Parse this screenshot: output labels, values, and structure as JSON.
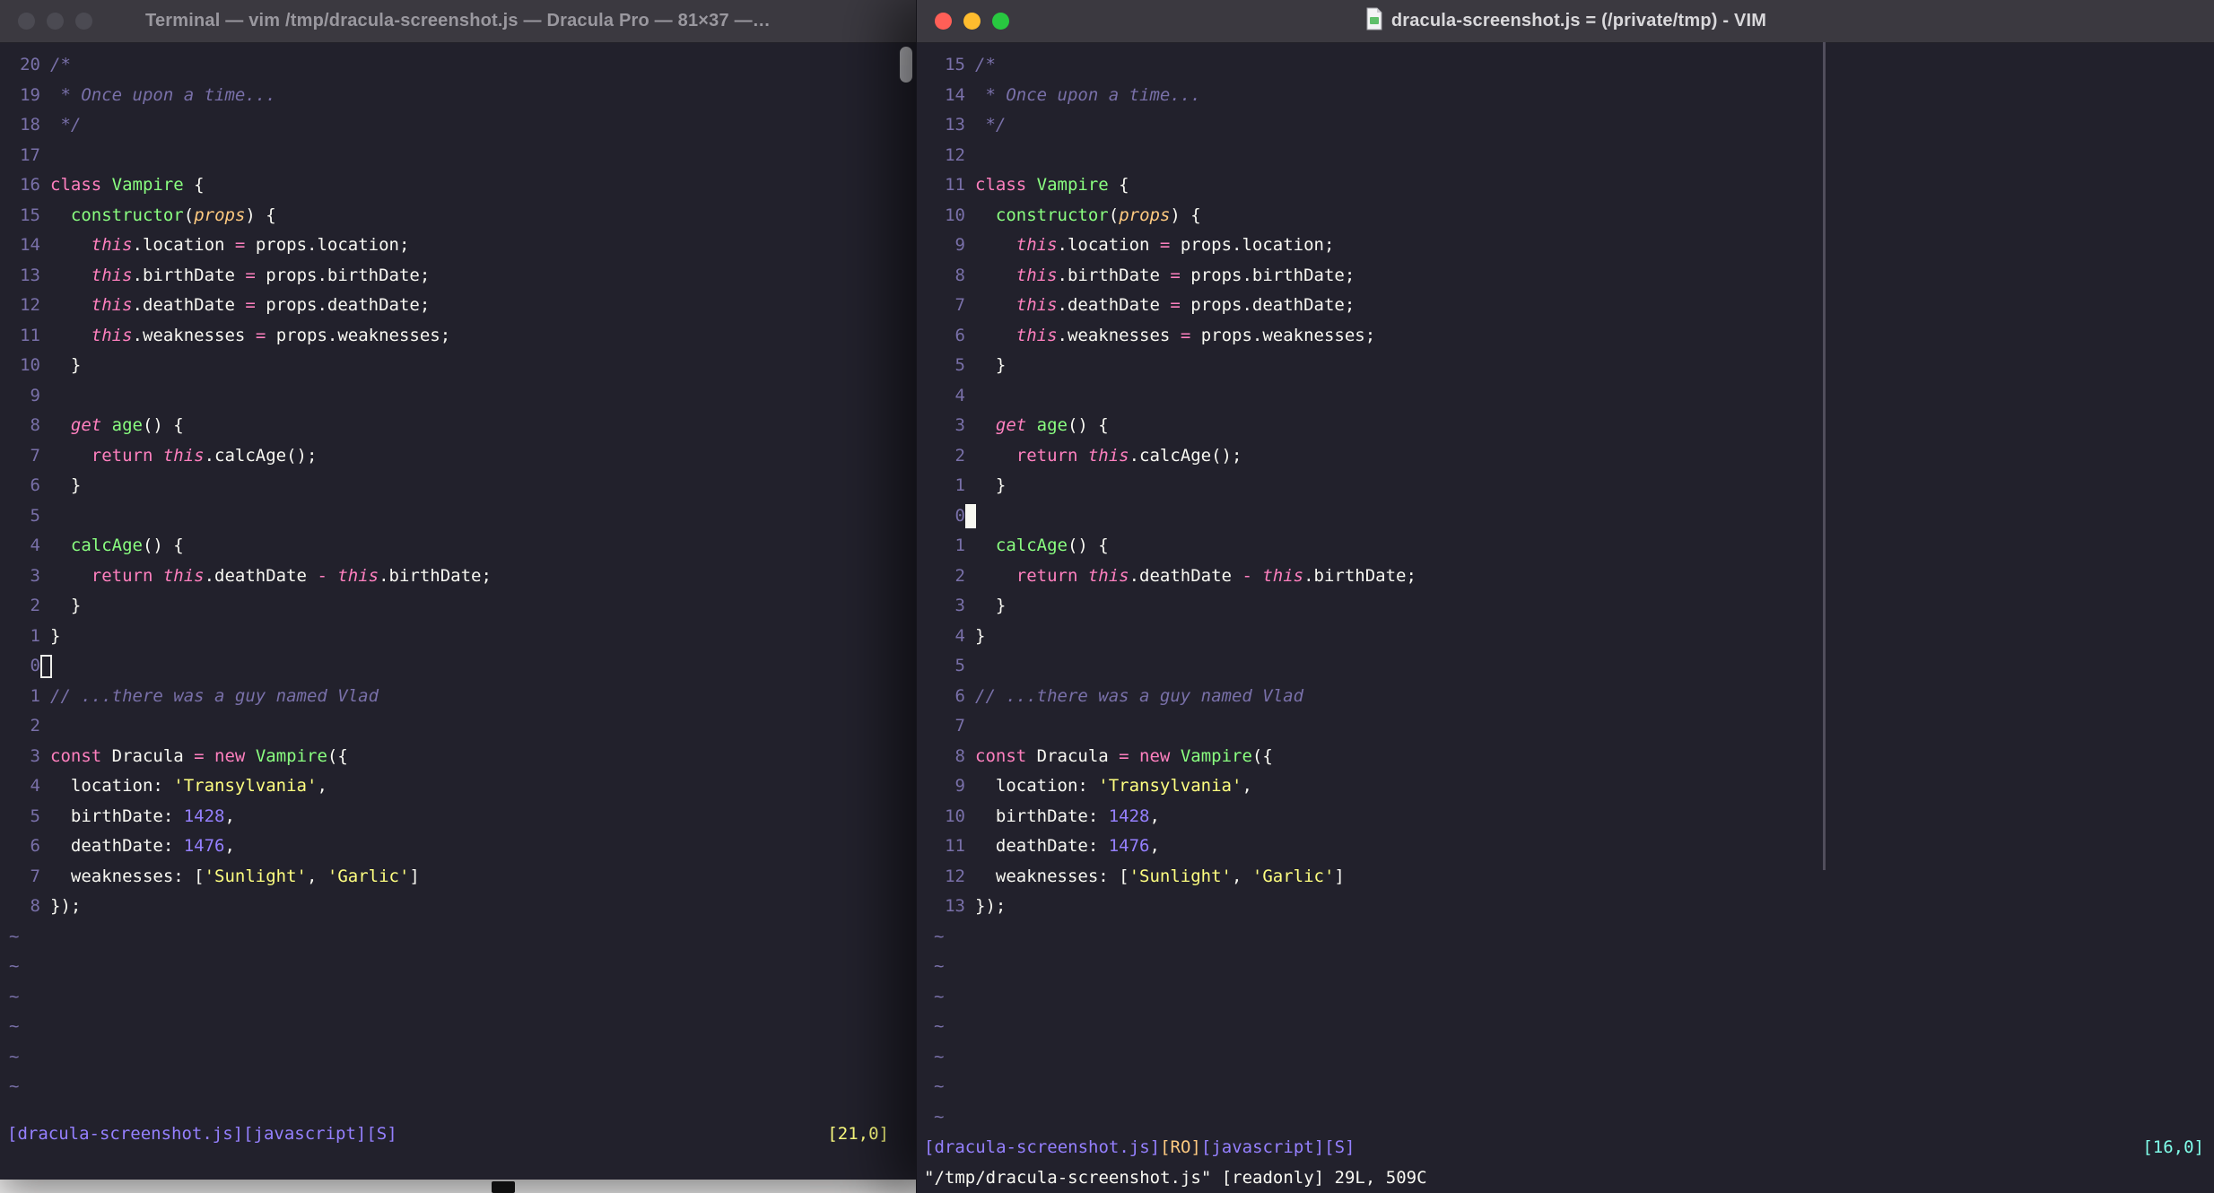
{
  "colors": {
    "background": "#22212C",
    "foreground": "#F8F8F2",
    "comment": "#7970A9",
    "pink": "#FF80BF",
    "green": "#8AFF80",
    "purple": "#9580FF",
    "yellow": "#FFFF80",
    "orange": "#FFCA80",
    "cyan": "#80FFEA",
    "titlebar": "#3b3940",
    "traffic_red": "#FF5F57",
    "traffic_yellow": "#FEBC2E",
    "traffic_green": "#28C840"
  },
  "tilde": "~",
  "left_window": {
    "title": "Terminal — vim /tmp/dracula-screenshot.js — Dracula Pro — 81×37 —…",
    "cursor_line": 21,
    "cursor_style": "hollow",
    "tilde_count": 6,
    "status_parts": [
      {
        "text": "[dracula-screenshot.js][javascript][S]",
        "color": "#9580FF"
      }
    ],
    "ruler": "[21,0]",
    "ruler_color": "#FFFF80",
    "command_line": ""
  },
  "right_window": {
    "title": "dracula-screenshot.js = (/private/tmp) - VIM",
    "cursor_line": 16,
    "cursor_style": "block",
    "tilde_count": 7,
    "status_parts": [
      {
        "text": "[dracula-screenshot.js]",
        "color": "#9580FF"
      },
      {
        "text": "[RO]",
        "color": "#FFCA80"
      },
      {
        "text": "[javascript][S]",
        "color": "#9580FF"
      }
    ],
    "ruler": "[16,0]",
    "ruler_color": "#80FFEA",
    "command_line": "\"/tmp/dracula-screenshot.js\" [readonly] 29L, 509C"
  },
  "code_lines": [
    [
      [
        "c",
        "/*"
      ]
    ],
    [
      [
        "c",
        " * Once upon a time..."
      ]
    ],
    [
      [
        "c",
        " */"
      ]
    ],
    [],
    [
      [
        "k",
        "class "
      ],
      [
        "f",
        "Vampire "
      ],
      [
        "",
        "{"
      ]
    ],
    [
      [
        "",
        "  "
      ],
      [
        "f",
        "constructor"
      ],
      [
        "",
        "("
      ],
      [
        "p",
        "props"
      ],
      [
        "",
        ") {"
      ]
    ],
    [
      [
        "",
        "    "
      ],
      [
        "ki",
        "this"
      ],
      [
        "",
        ".location "
      ],
      [
        "k",
        "="
      ],
      [
        "",
        " props.location;"
      ]
    ],
    [
      [
        "",
        "    "
      ],
      [
        "ki",
        "this"
      ],
      [
        "",
        ".birthDate "
      ],
      [
        "k",
        "="
      ],
      [
        "",
        " props.birthDate;"
      ]
    ],
    [
      [
        "",
        "    "
      ],
      [
        "ki",
        "this"
      ],
      [
        "",
        ".deathDate "
      ],
      [
        "k",
        "="
      ],
      [
        "",
        " props.deathDate;"
      ]
    ],
    [
      [
        "",
        "    "
      ],
      [
        "ki",
        "this"
      ],
      [
        "",
        ".weaknesses "
      ],
      [
        "k",
        "="
      ],
      [
        "",
        " props.weaknesses;"
      ]
    ],
    [
      [
        "",
        "  }"
      ]
    ],
    [],
    [
      [
        "",
        "  "
      ],
      [
        "ki",
        "get "
      ],
      [
        "f",
        "age"
      ],
      [
        "",
        "() {"
      ]
    ],
    [
      [
        "",
        "    "
      ],
      [
        "k",
        "return "
      ],
      [
        "ki",
        "this"
      ],
      [
        "",
        ".calcAge();"
      ]
    ],
    [
      [
        "",
        "  }"
      ]
    ],
    [],
    [
      [
        "",
        "  "
      ],
      [
        "f",
        "calcAge"
      ],
      [
        "",
        "() {"
      ]
    ],
    [
      [
        "",
        "    "
      ],
      [
        "k",
        "return "
      ],
      [
        "ki",
        "this"
      ],
      [
        "",
        ".deathDate "
      ],
      [
        "k",
        "- "
      ],
      [
        "ki",
        "this"
      ],
      [
        "",
        ".birthDate;"
      ]
    ],
    [
      [
        "",
        "  }"
      ]
    ],
    [
      [
        "",
        "}"
      ]
    ],
    [],
    [
      [
        "c",
        "// ...there was a guy named Vlad"
      ]
    ],
    [],
    [
      [
        "k",
        "const "
      ],
      [
        "",
        "Dracula "
      ],
      [
        "k",
        "= "
      ],
      [
        "k",
        "new "
      ],
      [
        "f",
        "Vampire"
      ],
      [
        "",
        "({"
      ]
    ],
    [
      [
        "",
        "  location: "
      ],
      [
        "s",
        "'Transylvania'"
      ],
      [
        "",
        ","
      ]
    ],
    [
      [
        "",
        "  birthDate: "
      ],
      [
        "n",
        "1428"
      ],
      [
        "",
        ","
      ]
    ],
    [
      [
        "",
        "  deathDate: "
      ],
      [
        "n",
        "1476"
      ],
      [
        "",
        ","
      ]
    ],
    [
      [
        "",
        "  weaknesses: ["
      ],
      [
        "s",
        "'Sunlight'"
      ],
      [
        "",
        ", "
      ],
      [
        "s",
        "'Garlic'"
      ],
      [
        "",
        "]"
      ]
    ],
    [
      [
        "",
        "});"
      ]
    ]
  ]
}
